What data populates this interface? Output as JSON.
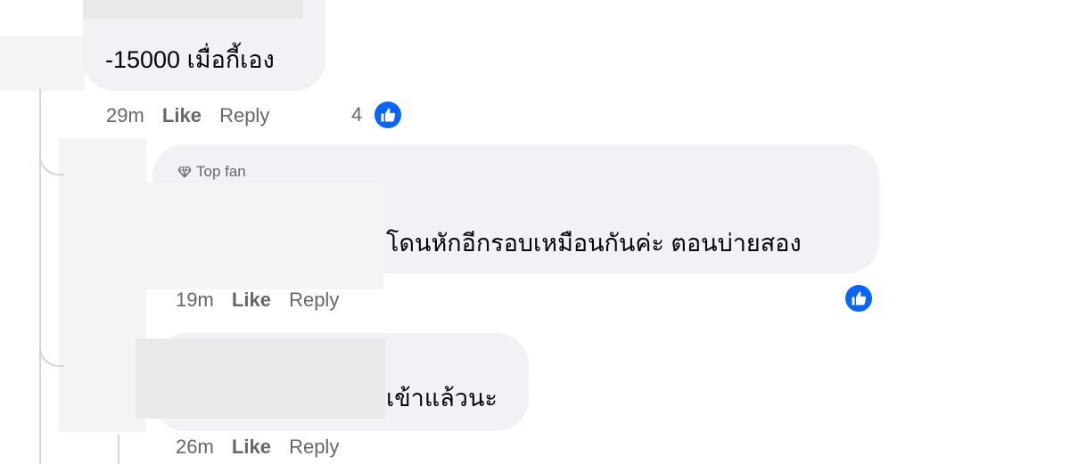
{
  "comments": [
    {
      "text": "-15000 เมื่อกี้เอง",
      "time": "29m",
      "like_label": "Like",
      "reply_label": "Reply",
      "reaction_count": "4"
    },
    {
      "badge": "Top fan",
      "text": "โดนหักอีกรอบเหมือนกันค่ะ ตอนบ่ายสอง",
      "time": "19m",
      "like_label": "Like",
      "reply_label": "Reply"
    },
    {
      "text": "เข้าแล้วนะ",
      "time": "26m",
      "like_label": "Like",
      "reply_label": "Reply"
    }
  ],
  "icons": {
    "reaction": "like-thumb-icon",
    "badge": "diamond-icon"
  },
  "colors": {
    "bubble": "#f0f2f5",
    "meta": "#65676b",
    "accent": "#0866ff"
  }
}
